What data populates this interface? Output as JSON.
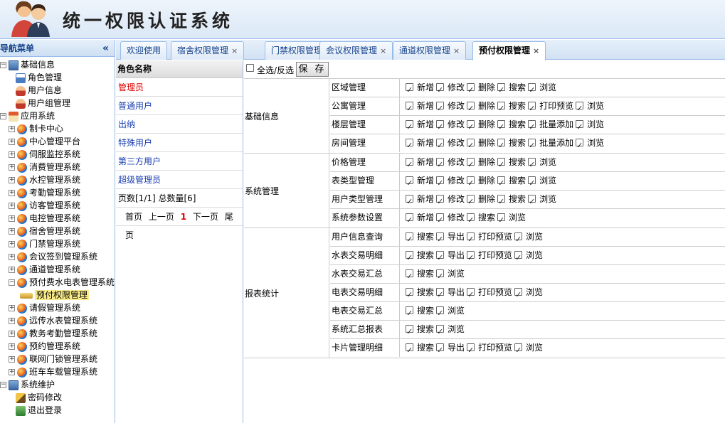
{
  "app": {
    "title": "统一权限认证系统"
  },
  "nav": {
    "title": "导航菜单",
    "tree": [
      {
        "label": "基础信息",
        "level": 0,
        "icon": "monitor",
        "exp": "-"
      },
      {
        "label": "角色管理",
        "level": 1,
        "icon": "role"
      },
      {
        "label": "用户信息",
        "level": 1,
        "icon": "user"
      },
      {
        "label": "用户组管理",
        "level": 1,
        "icon": "user"
      },
      {
        "label": "应用系统",
        "level": 0,
        "icon": "house",
        "exp": "-"
      },
      {
        "label": "制卡中心",
        "level": 1,
        "icon": "ball",
        "exp": "+"
      },
      {
        "label": "中心管理平台",
        "level": 1,
        "icon": "ball",
        "exp": "+"
      },
      {
        "label": "伺服监控系统",
        "level": 1,
        "icon": "ball",
        "exp": "+"
      },
      {
        "label": "消费管理系统",
        "level": 1,
        "icon": "ball",
        "exp": "+"
      },
      {
        "label": "水控管理系统",
        "level": 1,
        "icon": "ball",
        "exp": "+"
      },
      {
        "label": "考勤管理系统",
        "level": 1,
        "icon": "ball",
        "exp": "+"
      },
      {
        "label": "访客管理系统",
        "level": 1,
        "icon": "ball",
        "exp": "+"
      },
      {
        "label": "电控管理系统",
        "level": 1,
        "icon": "ball",
        "exp": "+"
      },
      {
        "label": "宿舍管理系统",
        "level": 1,
        "icon": "ball",
        "exp": "+"
      },
      {
        "label": "门禁管理系统",
        "level": 1,
        "icon": "ball",
        "exp": "+"
      },
      {
        "label": "会议签到管理系统",
        "level": 1,
        "icon": "ball",
        "exp": "+"
      },
      {
        "label": "通道管理系统",
        "level": 1,
        "icon": "ball",
        "exp": "+"
      },
      {
        "label": "预付费水电表管理系统",
        "level": 1,
        "icon": "ball",
        "exp": "-"
      },
      {
        "label": "预付权限管理",
        "level": 2,
        "icon": "key",
        "selected": true
      },
      {
        "label": "请假管理系统",
        "level": 1,
        "icon": "ball",
        "exp": "+"
      },
      {
        "label": "远传水表管理系统",
        "level": 1,
        "icon": "ball",
        "exp": "+"
      },
      {
        "label": "教务考勤管理系统",
        "level": 1,
        "icon": "ball",
        "exp": "+"
      },
      {
        "label": "预约管理系统",
        "level": 1,
        "icon": "ball",
        "exp": "+"
      },
      {
        "label": "联网门锁管理系统",
        "level": 1,
        "icon": "ball",
        "exp": "+"
      },
      {
        "label": "班车车载管理系统",
        "level": 1,
        "icon": "ball",
        "exp": "+"
      },
      {
        "label": "系统维护",
        "level": 0,
        "icon": "monitor",
        "exp": "-"
      },
      {
        "label": "密码修改",
        "level": 1,
        "icon": "pen"
      },
      {
        "label": "退出登录",
        "level": 1,
        "icon": "exit"
      }
    ]
  },
  "tabs": [
    {
      "label": "欢迎使用",
      "closable": false
    },
    {
      "label": "宿舍权限管理",
      "closable": true
    },
    {
      "label": "门禁权限管理",
      "closable": true
    },
    {
      "label": "会议权限管理",
      "closable": true
    },
    {
      "label": "通道权限管理",
      "closable": true
    },
    {
      "label": "预付权限管理",
      "closable": true,
      "active": true
    }
  ],
  "roles": {
    "header": "角色名称",
    "items": [
      "管理员",
      "普通用户",
      "出纳",
      "特殊用户",
      "第三方用户",
      "超级管理员"
    ],
    "pager_info": "页数[1/1]  总数量[6]",
    "pager": {
      "first": "首页",
      "prev": "上一页",
      "current": "1",
      "next": "下一页",
      "last": "尾页"
    }
  },
  "toolbar": {
    "select_all": "全选/反选",
    "save": "保 存"
  },
  "groups": [
    {
      "name": "基础信息",
      "items": [
        {
          "name": "区域管理",
          "actions": [
            "新增",
            "修改",
            "删除",
            "搜索",
            "浏览"
          ]
        },
        {
          "name": "公寓管理",
          "actions": [
            "新增",
            "修改",
            "删除",
            "搜索",
            "打印预览",
            "浏览"
          ]
        },
        {
          "name": "楼层管理",
          "actions": [
            "新增",
            "修改",
            "删除",
            "搜索",
            "批量添加",
            "浏览"
          ]
        },
        {
          "name": "房间管理",
          "actions": [
            "新增",
            "修改",
            "删除",
            "搜索",
            "批量添加",
            "浏览"
          ]
        }
      ]
    },
    {
      "name": "系统管理",
      "items": [
        {
          "name": "价格管理",
          "actions": [
            "新增",
            "修改",
            "删除",
            "搜索",
            "浏览"
          ]
        },
        {
          "name": "表类型管理",
          "actions": [
            "新增",
            "修改",
            "删除",
            "搜索",
            "浏览"
          ]
        },
        {
          "name": "用户类型管理",
          "actions": [
            "新增",
            "修改",
            "删除",
            "搜索",
            "浏览"
          ]
        },
        {
          "name": "系统参数设置",
          "actions": [
            "新增",
            "修改",
            "搜索",
            "浏览"
          ]
        }
      ]
    },
    {
      "name": "报表统计",
      "items": [
        {
          "name": "用户信息查询",
          "actions": [
            "搜索",
            "导出",
            "打印预览",
            "浏览"
          ]
        },
        {
          "name": "水表交易明细",
          "actions": [
            "搜索",
            "导出",
            "打印预览",
            "浏览"
          ]
        },
        {
          "name": "水表交易汇总",
          "actions": [
            "搜索",
            "浏览"
          ]
        },
        {
          "name": "电表交易明细",
          "actions": [
            "搜索",
            "导出",
            "打印预览",
            "浏览"
          ]
        },
        {
          "name": "电表交易汇总",
          "actions": [
            "搜索",
            "浏览"
          ]
        },
        {
          "name": "系统汇总报表",
          "actions": [
            "搜索",
            "浏览"
          ]
        },
        {
          "name": "卡片管理明细",
          "actions": [
            "搜索",
            "导出",
            "打印预览",
            "浏览"
          ]
        }
      ]
    }
  ]
}
